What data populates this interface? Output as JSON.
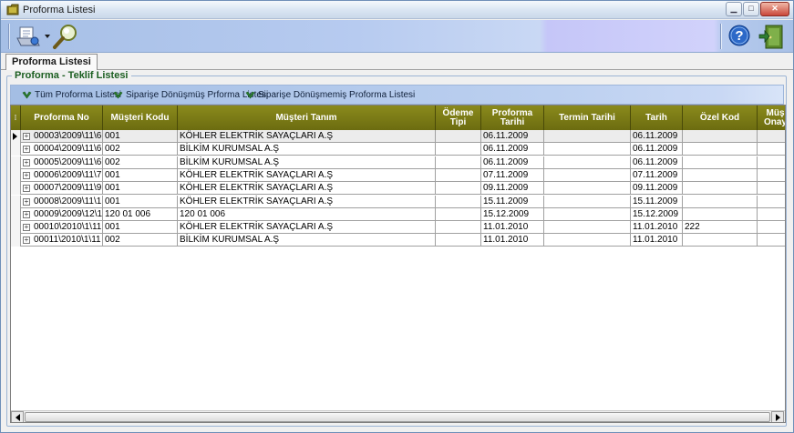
{
  "window": {
    "title": "Proforma Listesi"
  },
  "tabs": [
    {
      "label": "Proforma Listesi"
    }
  ],
  "group": {
    "legend": "Proforma - Teklif Listesi"
  },
  "filters": {
    "all": "Tüm Proforma Listesi",
    "converted": "Siparişe Dönüşmüş Prforma Listesi",
    "unconverted": "Siparişe Dönüşmemiş Proforma Listesi"
  },
  "grid": {
    "columns": [
      {
        "key": "proforma_no",
        "label": "Proforma No"
      },
      {
        "key": "musteri_kodu",
        "label": "Müşteri Kodu"
      },
      {
        "key": "musteri_tanim",
        "label": "Müşteri Tanım"
      },
      {
        "key": "odeme_tipi",
        "label": "Ödeme Tipi"
      },
      {
        "key": "proforma_tarihi",
        "label": "Proforma Tarihi"
      },
      {
        "key": "termin_tarihi",
        "label": "Termin Tarihi"
      },
      {
        "key": "tarih",
        "label": "Tarih"
      },
      {
        "key": "ozel_kod",
        "label": "Özel Kod"
      },
      {
        "key": "musteri_onay",
        "label": "Müş Onay"
      }
    ],
    "rows": [
      {
        "proforma_no": "00003\\2009\\11\\6",
        "musteri_kodu": "001",
        "musteri_tanim": "KÖHLER ELEKTRİK SAYAÇLARI A.Ş",
        "odeme_tipi": "",
        "proforma_tarihi": "06.11.2009",
        "termin_tarihi": "",
        "tarih": "06.11.2009",
        "ozel_kod": "",
        "musteri_onay": ""
      },
      {
        "proforma_no": "00004\\2009\\11\\6",
        "musteri_kodu": "002",
        "musteri_tanim": "BİLKİM KURUMSAL A.Ş",
        "odeme_tipi": "",
        "proforma_tarihi": "06.11.2009",
        "termin_tarihi": "",
        "tarih": "06.11.2009",
        "ozel_kod": "",
        "musteri_onay": ""
      },
      {
        "proforma_no": "00005\\2009\\11\\6",
        "musteri_kodu": "002",
        "musteri_tanim": "BİLKİM KURUMSAL A.Ş",
        "odeme_tipi": "",
        "proforma_tarihi": "06.11.2009",
        "termin_tarihi": "",
        "tarih": "06.11.2009",
        "ozel_kod": "",
        "musteri_onay": ""
      },
      {
        "proforma_no": "00006\\2009\\11\\7",
        "musteri_kodu": "001",
        "musteri_tanim": "KÖHLER ELEKTRİK SAYAÇLARI A.Ş",
        "odeme_tipi": "",
        "proforma_tarihi": "07.11.2009",
        "termin_tarihi": "",
        "tarih": "07.11.2009",
        "ozel_kod": "",
        "musteri_onay": ""
      },
      {
        "proforma_no": "00007\\2009\\11\\9",
        "musteri_kodu": "001",
        "musteri_tanim": "KÖHLER ELEKTRİK SAYAÇLARI A.Ş",
        "odeme_tipi": "",
        "proforma_tarihi": "09.11.2009",
        "termin_tarihi": "",
        "tarih": "09.11.2009",
        "ozel_kod": "",
        "musteri_onay": ""
      },
      {
        "proforma_no": "00008\\2009\\11\\1",
        "musteri_kodu": "001",
        "musteri_tanim": "KÖHLER ELEKTRİK SAYAÇLARI A.Ş",
        "odeme_tipi": "",
        "proforma_tarihi": "15.11.2009",
        "termin_tarihi": "",
        "tarih": "15.11.2009",
        "ozel_kod": "",
        "musteri_onay": ""
      },
      {
        "proforma_no": "00009\\2009\\12\\1",
        "musteri_kodu": "120 01 006",
        "musteri_tanim": "120 01 006",
        "odeme_tipi": "",
        "proforma_tarihi": "15.12.2009",
        "termin_tarihi": "",
        "tarih": "15.12.2009",
        "ozel_kod": "",
        "musteri_onay": ""
      },
      {
        "proforma_no": "00010\\2010\\1\\11",
        "musteri_kodu": "001",
        "musteri_tanim": "KÖHLER ELEKTRİK SAYAÇLARI A.Ş",
        "odeme_tipi": "",
        "proforma_tarihi": "11.01.2010",
        "termin_tarihi": "",
        "tarih": "11.01.2010",
        "ozel_kod": "222",
        "musteri_onay": ""
      },
      {
        "proforma_no": "00011\\2010\\1\\11",
        "musteri_kodu": "002",
        "musteri_tanim": "BİLKİM KURUMSAL A.Ş",
        "odeme_tipi": "",
        "proforma_tarihi": "11.01.2010",
        "termin_tarihi": "",
        "tarih": "11.01.2010",
        "ozel_kod": "",
        "musteri_onay": ""
      }
    ],
    "selected_row": 0
  },
  "icons": {
    "app": "folder-icon",
    "open": "printer-open-icon",
    "search": "magnifier-icon",
    "help": "help-icon",
    "exit": "exit-door-icon",
    "filter": "green-check-icon"
  },
  "colors": {
    "header_bg": "#7a7a14",
    "header_text": "#ffffff",
    "legend_text": "#1b5e20",
    "filter_check": "#2e7d32"
  }
}
